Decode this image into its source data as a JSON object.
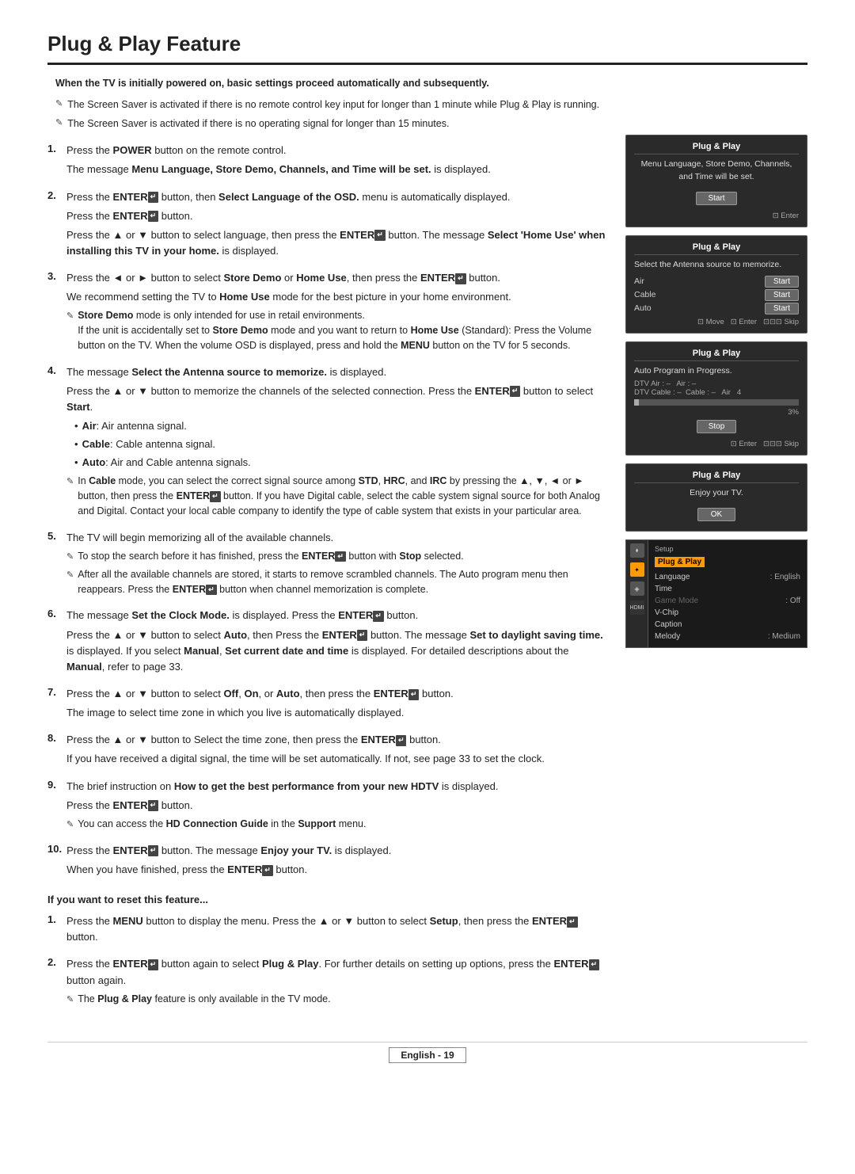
{
  "page": {
    "title": "Plug & Play Feature",
    "footer": "English - 19"
  },
  "intro": {
    "bold_note": "When the TV is initially powered on, basic settings proceed automatically and subsequently.",
    "notes": [
      "The Screen Saver is activated if there is no remote control key input for longer than 1 minute while Plug & Play is running.",
      "The Screen Saver is activated if there is no operating signal for longer than 15 minutes."
    ]
  },
  "steps": [
    {
      "num": 1,
      "lines": [
        "Press the <b>POWER</b> button on the remote control.",
        "The message <b>Menu Language, Store Demo, Channels, and Time will be set.</b> is displayed."
      ]
    },
    {
      "num": 2,
      "lines": [
        "Press the <b>ENTER</b> button, then <b>Select Language of the OSD.</b> menu is automatically displayed.",
        "Press the <b>ENTER</b> button.",
        "Press the ▲ or ▼ button to select language, then press the <b>ENTER</b> button. The message <b>Select 'Home Use' when installing this TV in your home.</b> is displayed."
      ]
    },
    {
      "num": 3,
      "lines": [
        "Press the ◄ or ► button to select <b>Store Demo</b> or <b>Home Use</b>, then press the <b>ENTER</b> button.",
        "We recommend setting the TV to <b>Home Use</b> mode for the best picture in your home environment."
      ],
      "subnotes": [
        "<b>Store Demo</b> mode is only intended for use in retail environments. If the unit is accidentally set to <b>Store Demo</b> mode and you want to return to <b>Home Use</b> (Standard): Press the Volume button on the TV. When the volume OSD is displayed, press and hold the <b>MENU</b> button on the TV for 5 seconds."
      ]
    },
    {
      "num": 4,
      "lines": [
        "The message <b>Select the Antenna source to memorize.</b> is displayed.",
        "Press the ▲ or ▼ button to memorize the channels of the selected connection. Press the <b>ENTER</b> button to select <b>Start</b>."
      ],
      "bullets": [
        "<b>Air</b>: Air antenna signal.",
        "<b>Cable</b>: Cable antenna signal.",
        "<b>Auto</b>: Air and Cable antenna signals."
      ],
      "subnotes": [
        "In <b>Cable</b> mode, you can select the correct signal source among <b>STD</b>, <b>HRC</b>, and <b>IRC</b> by pressing the ▲, ▼, ◄ or ► button, then press the <b>ENTER</b> button. If you have Digital cable, select the cable system signal source for both Analog and Digital. Contact your local cable company to identify the type of cable system that exists in your particular area."
      ]
    },
    {
      "num": 5,
      "lines": [
        "The TV will begin memorizing all of the available channels."
      ],
      "subnotes": [
        "To stop the search before it has finished, press the <b>ENTER</b> button with <b>Stop</b> selected.",
        "After all the available channels are stored, it starts to remove scrambled channels. The Auto program menu then reappears. Press the <b>ENTER</b> button when channel memorization is complete."
      ]
    },
    {
      "num": 6,
      "lines": [
        "The message <b>Set the Clock Mode.</b> is displayed. Press the <b>ENTER</b> button.",
        "Press the ▲ or ▼ button to select <b>Auto</b>, then Press the <b>ENTER</b> button. The message <b>Set to daylight saving time.</b> is displayed. If you select <b>Manual</b>, <b>Set current date and time</b> is displayed. For detailed descriptions about the <b>Manual</b>, refer to page 33."
      ]
    },
    {
      "num": 7,
      "lines": [
        "Press the ▲ or ▼ button to select <b>Off</b>, <b>On</b>, or <b>Auto</b>, then press the <b>ENTER</b> button.",
        "The image to select time zone in which you live is automatically displayed."
      ]
    },
    {
      "num": 8,
      "lines": [
        "Press the ▲ or ▼ button to Select the time zone, then press the <b>ENTER</b> button.",
        "If you have received a digital signal, the time will be set automatically. If not, see page 33 to set the clock."
      ]
    },
    {
      "num": 9,
      "lines": [
        "The brief instruction on <b>How to get the best performance from your new HDTV</b> is displayed.",
        "Press the <b>ENTER</b> button."
      ],
      "subnotes": [
        "You can access the <b>HD Connection Guide</b> in the <b>Support</b> menu."
      ]
    },
    {
      "num": 10,
      "lines": [
        "Press the <b>ENTER</b> button. The message <b>Enjoy your TV.</b> is displayed.",
        "When you have finished, press the <b>ENTER</b> button."
      ]
    }
  ],
  "reset_section": {
    "title": "If you want to reset this feature...",
    "steps": [
      {
        "lines": [
          "Press the <b>MENU</b> button to display the menu. Press the ▲ or ▼ button to select <b>Setup</b>, then press the <b>ENTER</b> button."
        ]
      },
      {
        "lines": [
          "Press the <b>ENTER</b> button again to select <b>Plug &amp; Play</b>. For further details on setting up options, press the <b>ENTER</b> button again."
        ],
        "subnotes": [
          "The <b>Plug &amp; Play</b> feature is only available in the TV mode."
        ]
      }
    ]
  },
  "tv_panels": {
    "panel1": {
      "title": "Plug & Play",
      "body": "Menu Language, Store Demo, Channels, and Time will be set.",
      "btn": "Start",
      "footer": "⊡ Enter"
    },
    "panel2": {
      "title": "Plug & Play",
      "body": "Select the Antenna source to memorize.",
      "rows": [
        {
          "label": "Air",
          "val": "Start"
        },
        {
          "label": "Cable",
          "val": "Start"
        },
        {
          "label": "Auto",
          "val": "Start"
        }
      ],
      "footer": "⊡ Move  ⊡ Enter  ⊡⊡⊡ Skip"
    },
    "panel3": {
      "title": "Plug & Play",
      "body": "Auto Program in Progress.",
      "rows": [
        {
          "label": "DTV Air : –   Air : –"
        },
        {
          "label": "DTV Cable : –   Cable : –   Air   4"
        }
      ],
      "percent": "3%",
      "btn": "Stop",
      "footer": "⊡ Enter  ⊡⊡⊡ Skip"
    },
    "panel4": {
      "title": "Plug & Play",
      "body": "Enjoy your TV.",
      "btn": "OK"
    }
  },
  "setup_panel": {
    "title": "Plug & Play",
    "items": [
      {
        "label": "Language",
        "val": ": English",
        "active": false
      },
      {
        "label": "Time",
        "val": "",
        "active": false
      },
      {
        "label": "Game Mode",
        "val": ": Off",
        "active": false,
        "dimmed": true
      },
      {
        "label": "V-Chip",
        "val": "",
        "active": false
      },
      {
        "label": "Caption",
        "val": "",
        "active": false
      },
      {
        "label": "Melody",
        "val": ": Medium",
        "active": false
      }
    ]
  }
}
